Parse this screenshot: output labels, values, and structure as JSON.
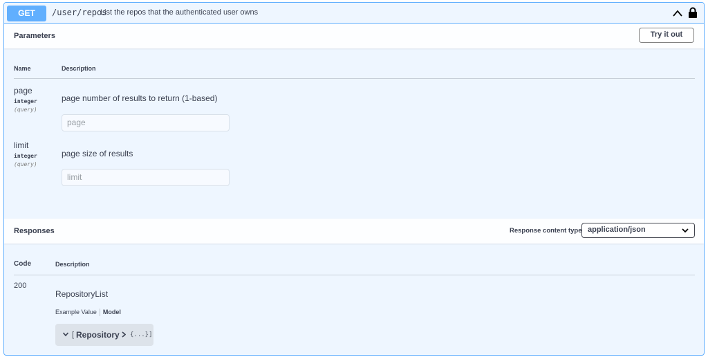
{
  "operation": {
    "method": "GET",
    "path": "/user/repos",
    "summary": "List the repos that the authenticated user owns",
    "icons": {
      "collapse": "chevron-up-icon",
      "auth": "lock-icon"
    },
    "colors": {
      "method_bg": "#61affe",
      "block_bg": "#eef6ff",
      "border": "#61affe"
    }
  },
  "parameters": {
    "title": "Parameters",
    "try_button": "Try it out",
    "col_name": "Name",
    "col_description": "Description",
    "items": [
      {
        "name": "page",
        "type": "integer",
        "in": "(query)",
        "description": "page number of results to return (1-based)",
        "placeholder": "page"
      },
      {
        "name": "limit",
        "type": "integer",
        "in": "(query)",
        "description": "page size of results",
        "placeholder": "limit"
      }
    ]
  },
  "responses": {
    "title": "Responses",
    "content_type_label": "Response content type",
    "content_type_value": "application/json",
    "col_code": "Code",
    "col_description": "Description",
    "items": [
      {
        "code": "200",
        "description": "RepositoryList",
        "tab_example": "Example Value",
        "tab_model": "Model",
        "model": {
          "open_bracket": "[",
          "name": "Repository",
          "collapsed": "{...}]"
        }
      }
    ]
  }
}
